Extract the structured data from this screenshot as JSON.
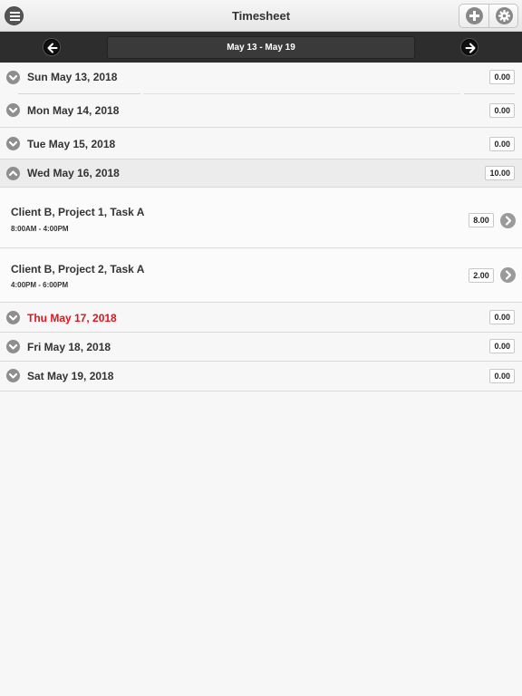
{
  "header": {
    "title": "Timesheet",
    "menu_icon": "menu-icon",
    "add_icon": "plus-icon",
    "settings_icon": "gear-icon"
  },
  "week_nav": {
    "range": "May 13 - May 19",
    "prev_icon": "arrow-left-icon",
    "next_icon": "arrow-right-icon"
  },
  "days": [
    {
      "label": "Sun May 13, 2018",
      "hours": "0.00",
      "expanded": false,
      "today": false
    },
    {
      "label": "Mon May 14, 2018",
      "hours": "0.00",
      "expanded": false,
      "today": false
    },
    {
      "label": "Tue May 15, 2018",
      "hours": "0.00",
      "expanded": false,
      "today": false
    },
    {
      "label": "Wed May 16, 2018",
      "hours": "10.00",
      "expanded": true,
      "today": false
    },
    {
      "label": "Thu May 17, 2018",
      "hours": "0.00",
      "expanded": false,
      "today": true
    },
    {
      "label": "Fri May 18, 2018",
      "hours": "0.00",
      "expanded": false,
      "today": false
    },
    {
      "label": "Sat May 19, 2018",
      "hours": "0.00",
      "expanded": false,
      "today": false
    }
  ],
  "entries": [
    {
      "title": "Client B, Project 1, Task A",
      "time": "8:00AM - 4:00PM",
      "hours": "8.00"
    },
    {
      "title": "Client B, Project 2, Task A",
      "time": "4:00PM - 6:00PM",
      "hours": "2.00"
    }
  ],
  "colors": {
    "today_text": "#e0141c",
    "nav_bar": "#2d2d2d"
  }
}
